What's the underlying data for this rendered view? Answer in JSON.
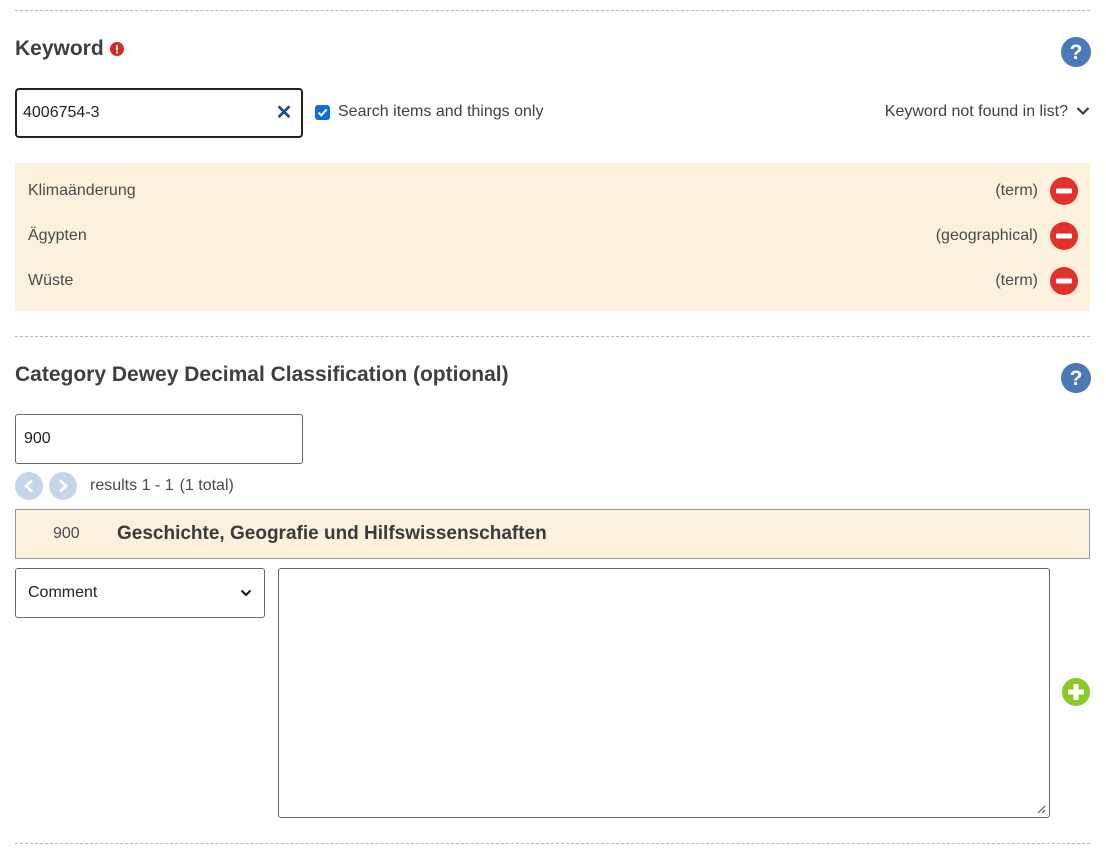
{
  "keyword_section": {
    "title": "Keyword",
    "required_icon": "exclamation-circle-icon",
    "help_icon": "question-circle-icon",
    "input_value": "4006754-3",
    "clear_icon": "close-icon",
    "checkbox_label": "Search items and things only",
    "checkbox_checked": true,
    "not_found_label": "Keyword not found in list?",
    "items": [
      {
        "label": "Klimaänderung",
        "type": "(term)"
      },
      {
        "label": "Ägypten",
        "type": "(geographical)"
      },
      {
        "label": "Wüste",
        "type": "(term)"
      }
    ]
  },
  "ddc_section": {
    "title": "Category Dewey Decimal Classification (optional)",
    "help_icon": "question-circle-icon",
    "input_value": "900",
    "results_text": "results 1 - 1",
    "total_text": "(1 total)",
    "result": {
      "code": "900",
      "label": "Geschichte, Geografie und Hilfswissenschaften"
    },
    "comment_select_value": "Comment",
    "comment_text": ""
  },
  "colors": {
    "highlight_bg": "#fcf1dc",
    "remove_red": "#e0322b",
    "add_green": "#8ac926",
    "help_blue": "#4a79b8",
    "checkbox_blue": "#0b6fd6"
  }
}
